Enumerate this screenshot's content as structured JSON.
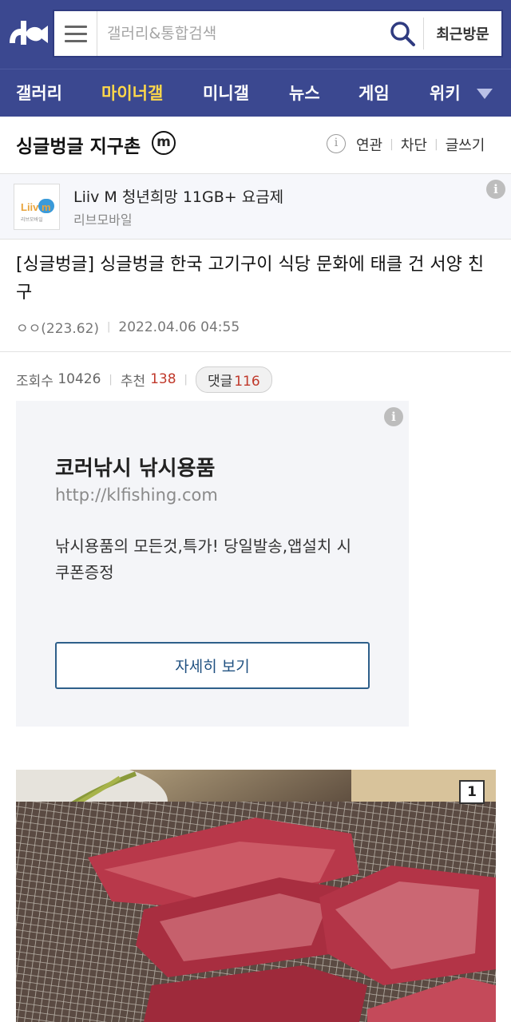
{
  "header": {
    "search_placeholder": "갤러리&통합검색",
    "recent_label": "최근방문"
  },
  "nav": {
    "items": [
      {
        "label": "갤러리"
      },
      {
        "label": "마이너갤"
      },
      {
        "label": "미니갤"
      },
      {
        "label": "뉴스"
      },
      {
        "label": "게임"
      },
      {
        "label": "위키"
      }
    ],
    "active_color": "#ffd84a",
    "bar_color": "#3b4890"
  },
  "gallery": {
    "title": "싱글벙글 지구촌",
    "badge": "m",
    "links": [
      "연관",
      "차단",
      "글쓰기"
    ]
  },
  "top_ad": {
    "logo_text": "Liiv m",
    "logo_sub": "리브모바일",
    "title": "Liiv M 청년희망 11GB+ 요금제",
    "advertiser": "리브모바일"
  },
  "post": {
    "title": "[싱글벙글] 싱글벙글 한국 고기구이 식당 문화에 태클 건 서양 친구",
    "author": "ㅇㅇ(223.62)",
    "date": "2022.04.06 04:55",
    "views_label": "조회수",
    "views": "10426",
    "recommend_label": "추천",
    "recommend": "138",
    "comments_label": "댓글",
    "comments": "116"
  },
  "display_ad": {
    "title": "코러낚시 낚시용품",
    "url": "http://klfishing.com",
    "description": "낚시용품의 모든것,특가! 당일발송,앱설치 시 쿠폰증정",
    "button": "자세히 보기"
  },
  "photo": {
    "index": "1"
  }
}
